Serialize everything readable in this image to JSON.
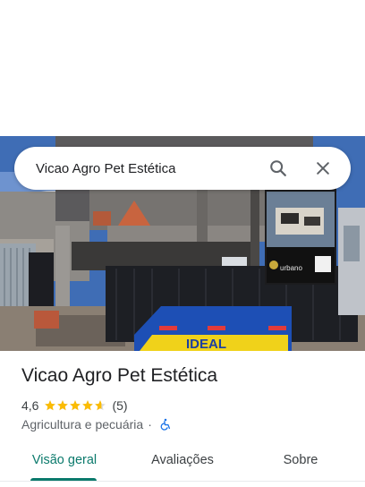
{
  "search": {
    "query": "Vicao Agro Pet Estética",
    "search_icon": "search-icon",
    "clear_icon": "close-icon"
  },
  "photo": {
    "sign_brand": "urbano",
    "dumpster_label": "IDEAL"
  },
  "place": {
    "title": "Vicao Agro Pet Estética",
    "rating": "4,6",
    "stars": 4.6,
    "reviews": "(5)",
    "category": "Agricultura e pecuária",
    "separator": "·",
    "accessibility_icon": "wheelchair-icon"
  },
  "tabs": [
    {
      "label": "Visão geral",
      "active": true
    },
    {
      "label": "Avaliações",
      "active": false
    },
    {
      "label": "Sobre",
      "active": false
    }
  ],
  "colors": {
    "accent": "#0b7a6c",
    "star": "#fbbc04",
    "wheelchair": "#1a73e8"
  }
}
